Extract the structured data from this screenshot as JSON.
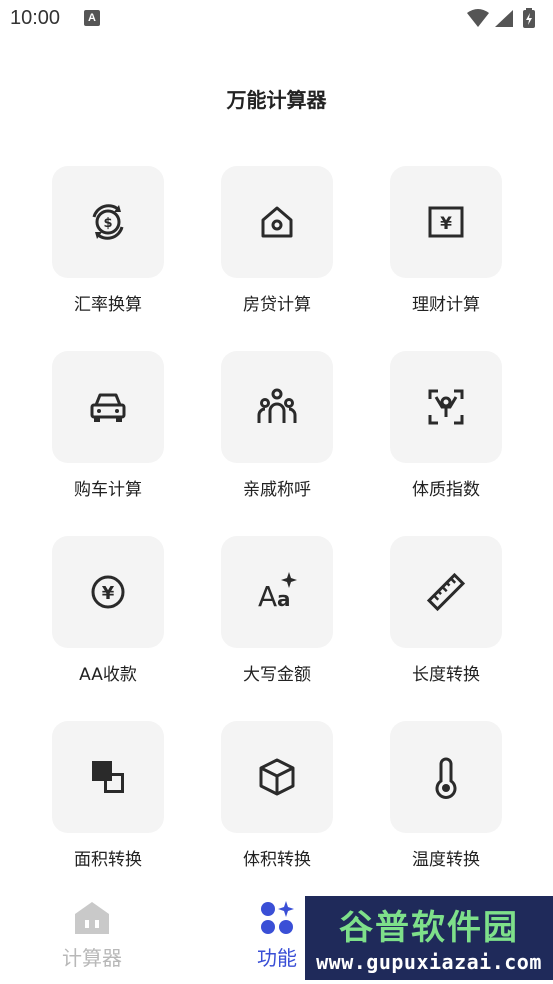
{
  "status_bar": {
    "time": "10:00",
    "notification_letter": "A"
  },
  "page_title": "万能计算器",
  "tools": [
    {
      "label": "汇率换算",
      "icon": "currency-exchange-icon"
    },
    {
      "label": "房贷计算",
      "icon": "house-icon"
    },
    {
      "label": "理财计算",
      "icon": "yen-banknote-icon"
    },
    {
      "label": "购车计算",
      "icon": "car-icon"
    },
    {
      "label": "亲戚称呼",
      "icon": "family-icon"
    },
    {
      "label": "体质指数",
      "icon": "body-scan-icon"
    },
    {
      "label": "AA收款",
      "icon": "yen-coin-icon"
    },
    {
      "label": "大写金额",
      "icon": "text-sparkle-icon"
    },
    {
      "label": "长度转换",
      "icon": "ruler-icon"
    },
    {
      "label": "面积转换",
      "icon": "overlap-squares-icon"
    },
    {
      "label": "体积转换",
      "icon": "cube-icon"
    },
    {
      "label": "温度转换",
      "icon": "thermometer-icon"
    }
  ],
  "bottom_nav": {
    "calculator": {
      "label": "计算器",
      "icon": "home-icon"
    },
    "functions": {
      "label": "功能",
      "icon": "apps-icon"
    }
  },
  "watermark": {
    "title": "谷普软件园",
    "url": "www.gupuxiazai.com"
  },
  "colors": {
    "accent": "#3a4fd6",
    "tile_bg": "#f4f4f4",
    "inactive": "#b8b8b8",
    "icon": "#2a2a2a"
  }
}
